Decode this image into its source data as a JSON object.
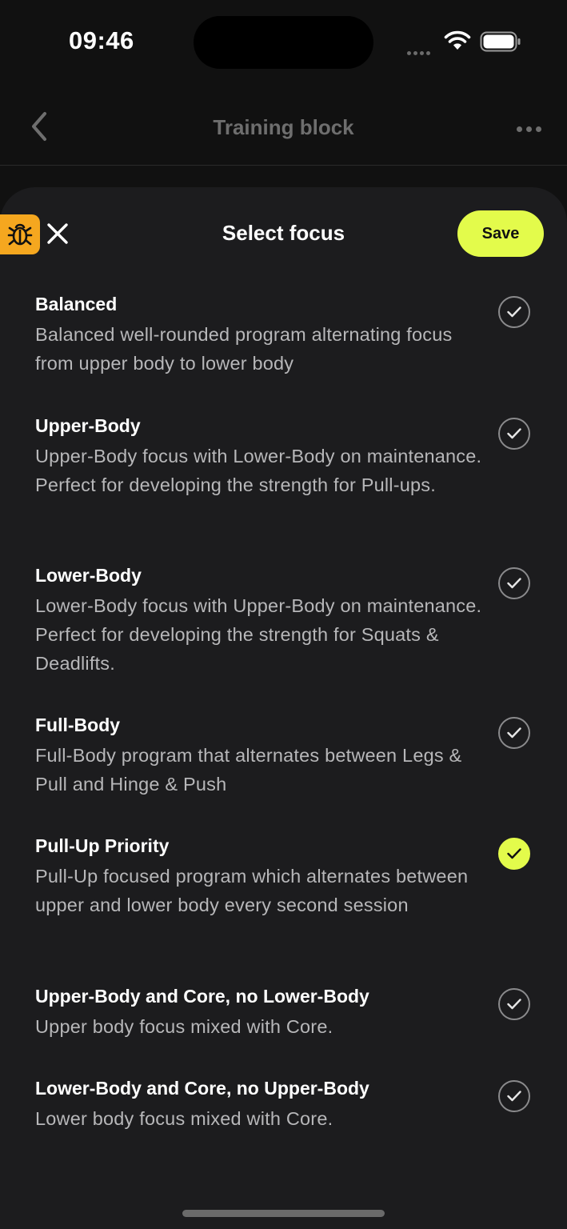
{
  "status_bar": {
    "time": "09:46"
  },
  "nav": {
    "title": "Training block"
  },
  "sheet": {
    "title": "Select focus",
    "save_label": "Save"
  },
  "options": [
    {
      "title": "Balanced",
      "description": "Balanced well-rounded program alternating focus from upper body to lower body",
      "selected": false
    },
    {
      "title": "Upper-Body",
      "description": "Upper-Body focus with Lower-Body on maintenance. Perfect for developing the strength for Pull-ups.",
      "selected": false
    },
    {
      "title": "Lower-Body",
      "description": "Lower-Body focus with Upper-Body on maintenance. Perfect for developing the strength for Squats & Deadlifts.",
      "selected": false
    },
    {
      "title": "Full-Body",
      "description": "Full-Body program that alternates between Legs & Pull and Hinge & Push",
      "selected": false
    },
    {
      "title": "Pull-Up Priority",
      "description": "Pull-Up focused program which alternates between upper and lower body every second session",
      "selected": true
    },
    {
      "title": "Upper-Body and Core, no Lower-Body",
      "description": "Upper body focus mixed with Core.",
      "selected": false
    },
    {
      "title": "Lower-Body and Core, no Upper-Body",
      "description": "Lower body focus mixed with Core.",
      "selected": false
    }
  ],
  "colors": {
    "accent": "#e3fb4b",
    "debug": "#f5a71f",
    "sheet_bg": "#1c1c1e"
  },
  "icons": {
    "back": "chevron-left-icon",
    "more": "more-horizontal-icon",
    "debug": "bug-icon",
    "close": "close-icon",
    "check": "checkmark-icon"
  }
}
